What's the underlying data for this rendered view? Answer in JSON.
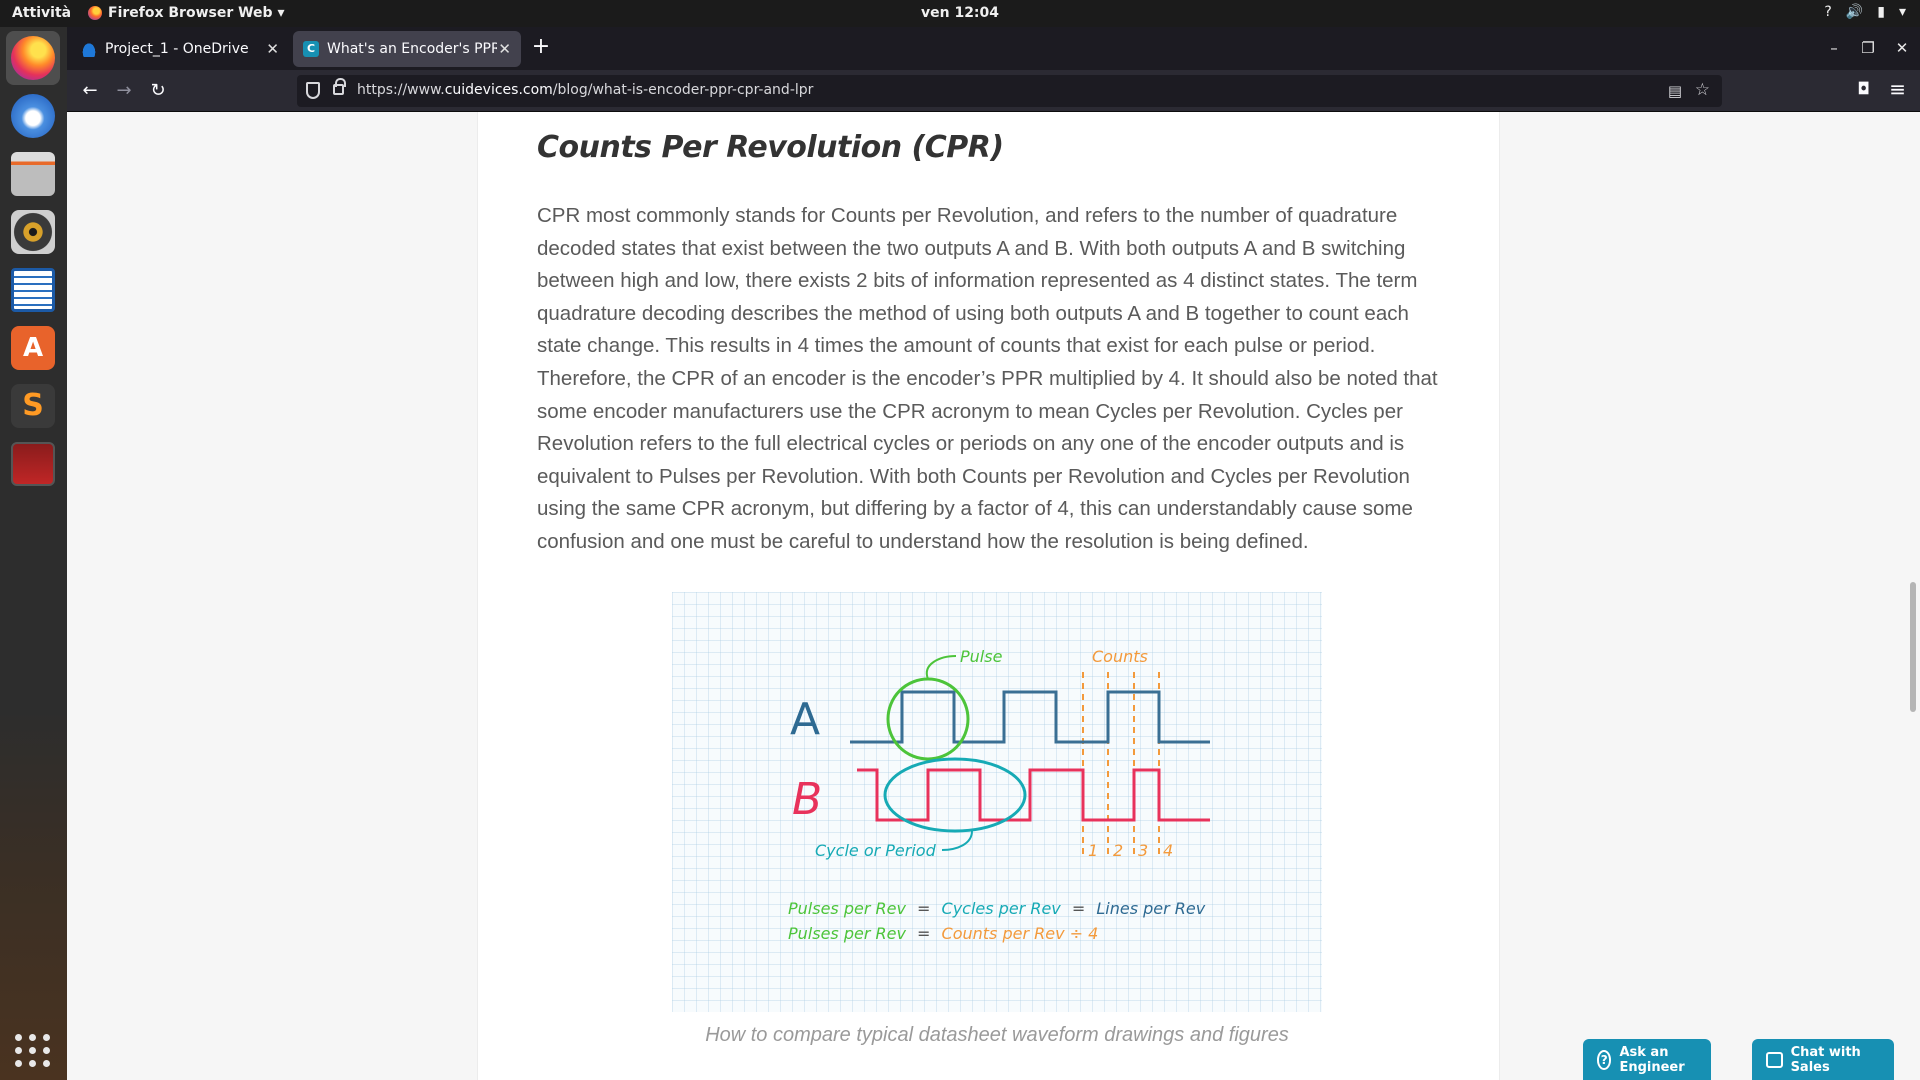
{
  "os_bar": {
    "activities": "Attività",
    "app_name": "Firefox Browser Web ▾",
    "clock": "ven 12:04",
    "tray_icons": [
      "help-icon",
      "volume-icon",
      "battery-icon",
      "power-menu-icon"
    ],
    "tray_glyphs": [
      "?",
      "🔊",
      "▮",
      "▾"
    ]
  },
  "dock": {
    "apps": [
      "firefox",
      "thunderbird",
      "files",
      "rhythmbox",
      "libreoffice-writer",
      "software-center",
      "sublime-text",
      "terminal-app"
    ],
    "show_apps_label": "show-applications"
  },
  "browser": {
    "tabs": [
      {
        "title": "Project_1 - OneDrive",
        "active": false
      },
      {
        "title": "What's an Encoder's PPR",
        "active": true
      }
    ],
    "new_tab": "+",
    "window_controls": [
      "–",
      "❐",
      "✕"
    ],
    "url_prefix": "https://www.",
    "url_host": "cuidevices.com",
    "url_path": "/blog/what-is-encoder-ppr-cpr-and-lpr",
    "nav": {
      "back": "←",
      "forward": "→",
      "reload": "↻"
    },
    "reader_icon": "▤",
    "bookmark_icon": "☆",
    "pocket_icon": "◘",
    "menu_icon": "≡"
  },
  "article": {
    "heading": "Counts Per Revolution (CPR)",
    "paragraph": "CPR most commonly stands for Counts per Revolution, and refers to the number of quadrature decoded states that exist between the two outputs A and B. With both outputs A and B switching between high and low, there exists 2 bits of information represented as 4 distinct states. The term quadrature decoding describes the method of using both outputs A and B together to count each state change. This results in 4 times the amount of counts that exist for each pulse or period. Therefore, the CPR of an encoder is the encoder’s PPR multiplied by 4. It should also be noted that some encoder manufacturers use the CPR acronym to mean Cycles per Revolution. Cycles per Revolution refers to the full electrical cycles or periods on any one of the encoder outputs and is equivalent to Pulses per Revolution. With both Counts per Revolution and Cycles per Revolution using the same CPR acronym, but differing by a factor of 4, this can understandably cause some confusion and one must be careful to understand how the resolution is being defined.",
    "figure": {
      "label_a": "A",
      "label_b": "B",
      "pulse_label": "Pulse",
      "counts_label": "Counts",
      "cycle_label": "Cycle or Period",
      "count_numbers": [
        "1",
        "2",
        "3",
        "4"
      ],
      "eq1": {
        "a": "Pulses per Rev",
        "op1": "=",
        "b": "Cycles per Rev",
        "op2": "=",
        "c": "Lines per Rev"
      },
      "eq2": {
        "a": "Pulses per Rev",
        "op1": "=",
        "b": "Counts per Rev ÷ 4"
      },
      "colors": {
        "a_wave": "#3a6f94",
        "b_wave": "#e8325b",
        "pulse": "#4cc43a",
        "cycle": "#16aab5",
        "counts": "#f39a3c",
        "lines": "#2e6a92"
      }
    },
    "caption": "How to compare typical datasheet waveform drawings and figures"
  },
  "cta": {
    "ask_engineer": "Ask an Engineer",
    "chat_sales": "Chat with Sales",
    "ask_icon": "?"
  }
}
